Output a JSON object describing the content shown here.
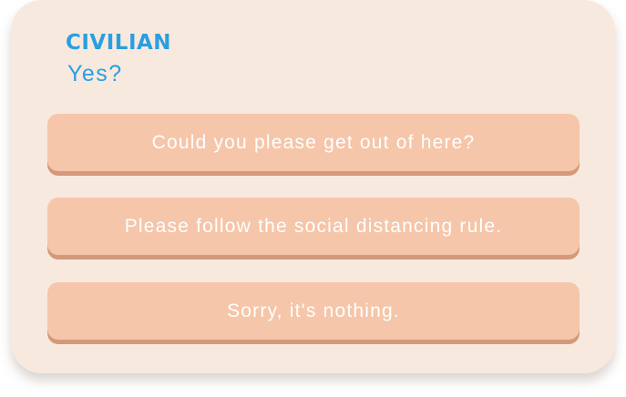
{
  "dialog": {
    "speaker": "CIVILIAN",
    "line": "Yes?"
  },
  "choices": [
    {
      "label": "Could you please get out of here?"
    },
    {
      "label": "Please follow the social distancing rule."
    },
    {
      "label": "Sorry, it's nothing."
    }
  ],
  "colors": {
    "panel_background": "#f8e9df",
    "speaker_text": "#2a9fe0",
    "choice_background": "#f5c6a9",
    "choice_shadow": "#d4997a",
    "choice_text": "#ffffff"
  }
}
